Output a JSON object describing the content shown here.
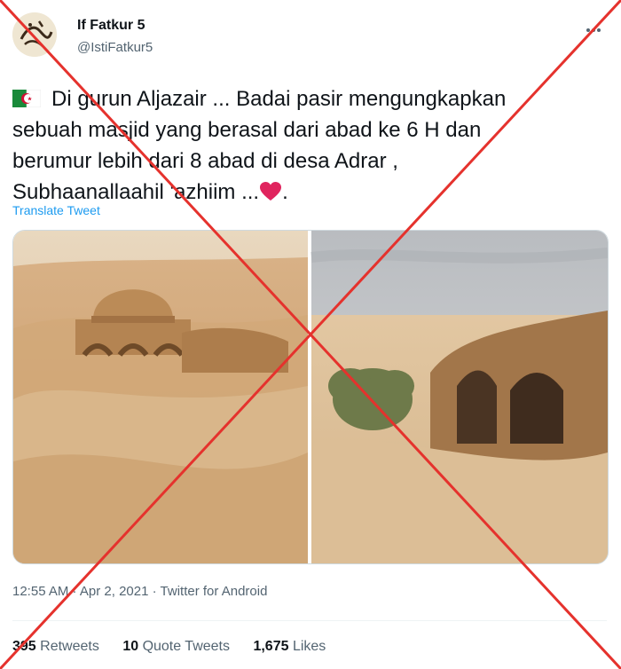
{
  "author": {
    "display_name": "If Fatkur 5",
    "handle": "@IstiFatkur5",
    "avatar_icon": "calligraphy-avatar"
  },
  "tweet": {
    "flag_icon": "algeria-flag-icon",
    "line1": "Di gurun Aljazair ... Badai pasir mengungkapkan",
    "line2": "sebuah masjid yang berasal dari abad ke 6 H dan",
    "line3": "berumur lebih dari 8 abad di desa Adrar ,",
    "line4_prefix": "Subhaanallaahil 'azhiim ...",
    "line4_suffix": ".",
    "heart_icon": "red-heart-emoji",
    "translate_label": "Translate Tweet"
  },
  "meta": {
    "time": "12:55 AM",
    "sep1": " · ",
    "date": "Apr 2, 2021",
    "sep2": " · ",
    "source": "Twitter for Android"
  },
  "stats": {
    "retweets_count": "395",
    "retweets_label": "Retweets",
    "quotes_count": "10",
    "quotes_label": "Quote Tweets",
    "likes_count": "1,675",
    "likes_label": "Likes"
  },
  "colors": {
    "link": "#1d9bf0",
    "cross": "#e5322d",
    "sand": "#d8b68a"
  }
}
